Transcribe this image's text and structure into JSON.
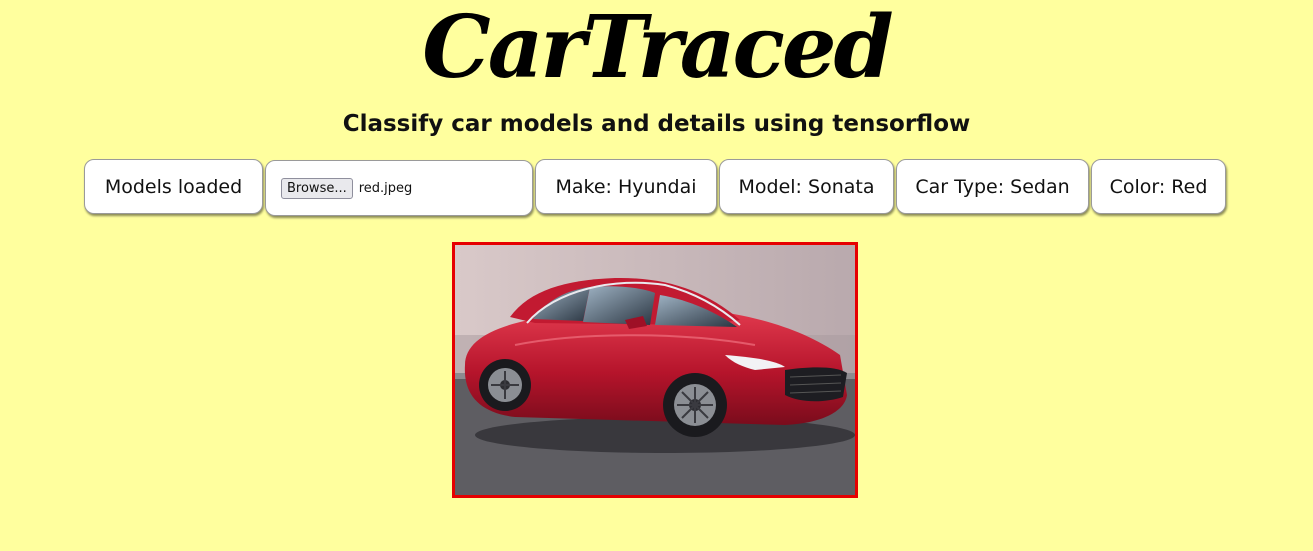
{
  "header": {
    "title": "CarTraced",
    "subtitle": "Classify car models and details using tensorflow"
  },
  "toolbar": {
    "status_label": "Models loaded",
    "file_input": {
      "button_label": "Browse...",
      "file_name": "red.jpeg"
    },
    "make_label": "Make: Hyundai",
    "model_label": "Model: Sonata",
    "car_type_label": "Car Type: Sedan",
    "color_label": "Color: Red"
  },
  "image": {
    "description_name": "uploaded-car-photo",
    "border_color": "#e60000"
  },
  "colors": {
    "page_background": "#ffff9e",
    "chip_background": "#ffffff",
    "accent_red": "#e60000"
  }
}
